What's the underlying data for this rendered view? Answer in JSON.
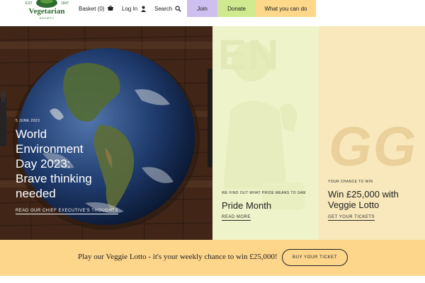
{
  "header": {
    "logo": {
      "name": "Vegetarian",
      "sub": "SOCIETY",
      "year_left": "EST",
      "year_right": "1847"
    },
    "nav": {
      "basket_label": "Basket (0)",
      "login_label": "Log In",
      "search_label": "Search"
    },
    "buttons": {
      "join": "Join",
      "donate": "Donate",
      "what_you_can_do": "What you can do"
    }
  },
  "hero": {
    "feature": {
      "date": "5 JUNE 2023",
      "title_lines": [
        "World",
        "Environment",
        "Day 2023:",
        "Brave thinking",
        "needed"
      ],
      "link": "READ OUR CHIEF EXECUTIVE'S THOUGHTS"
    },
    "pride": {
      "kicker": "WE FIND OUT WHAT PRIDE MEANS TO SAM",
      "title": "Pride Month",
      "link": "READ MORE",
      "bg_letters": "EN"
    },
    "lotto": {
      "kicker": "YOUR CHANCE TO WIN",
      "title_lines": [
        "Win £25,000 with",
        "Veggie Lotto"
      ],
      "link": "GET YOUR TICKETS",
      "bg_letters": "GG"
    }
  },
  "lotto_bar": {
    "text": "Play our Veggie Lotto - it's your weekly chance to win £25,000!",
    "button": "BUY YOUR TICKET"
  },
  "colors": {
    "join_bg": "#cdbff0",
    "donate_bg": "#cfea8e",
    "what_bg": "#fdd78a",
    "lotto_bar_bg": "#fdd58b",
    "brand_green": "#2e6b2f"
  },
  "icons": {
    "basket": "basket-icon",
    "login": "user-icon",
    "search": "search-icon"
  }
}
